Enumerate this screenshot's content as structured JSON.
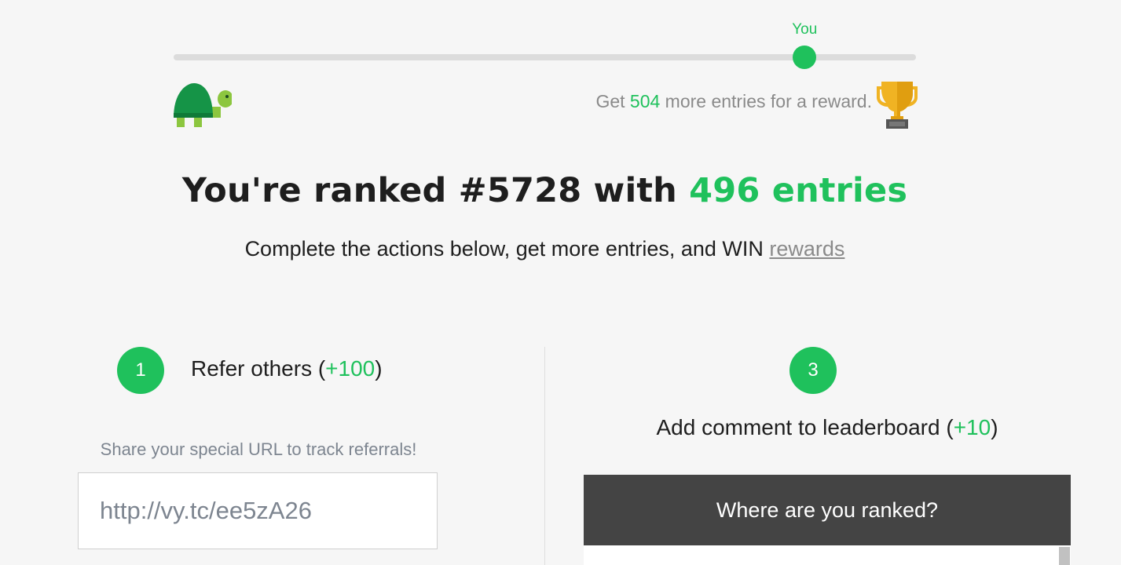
{
  "progress": {
    "you_label": "You",
    "fraction": 0.85,
    "reward_prefix": "Get ",
    "reward_count": "504",
    "reward_suffix": " more entries for a reward."
  },
  "headline": {
    "prefix": "You're ranked #5728 with ",
    "entries": "496 entries"
  },
  "subline": {
    "text": "Complete the actions below, get more entries, and WIN ",
    "link": "rewards"
  },
  "steps": [
    {
      "number": "1",
      "title": "Refer others (",
      "points": "+100",
      "close": ")",
      "note": "Share your special URL to track referrals!",
      "url_value": "http://vy.tc/ee5zA26"
    },
    {
      "number": "3",
      "title": "Add comment to leaderboard (",
      "points": "+10",
      "close": ")",
      "panel_header": "Where are you ranked?"
    }
  ],
  "colors": {
    "accent": "#1fc15c",
    "header_bg": "#444444",
    "page_bg": "#f6f6f6"
  },
  "icons": {
    "start": "turtle-icon",
    "goal": "trophy-icon"
  }
}
